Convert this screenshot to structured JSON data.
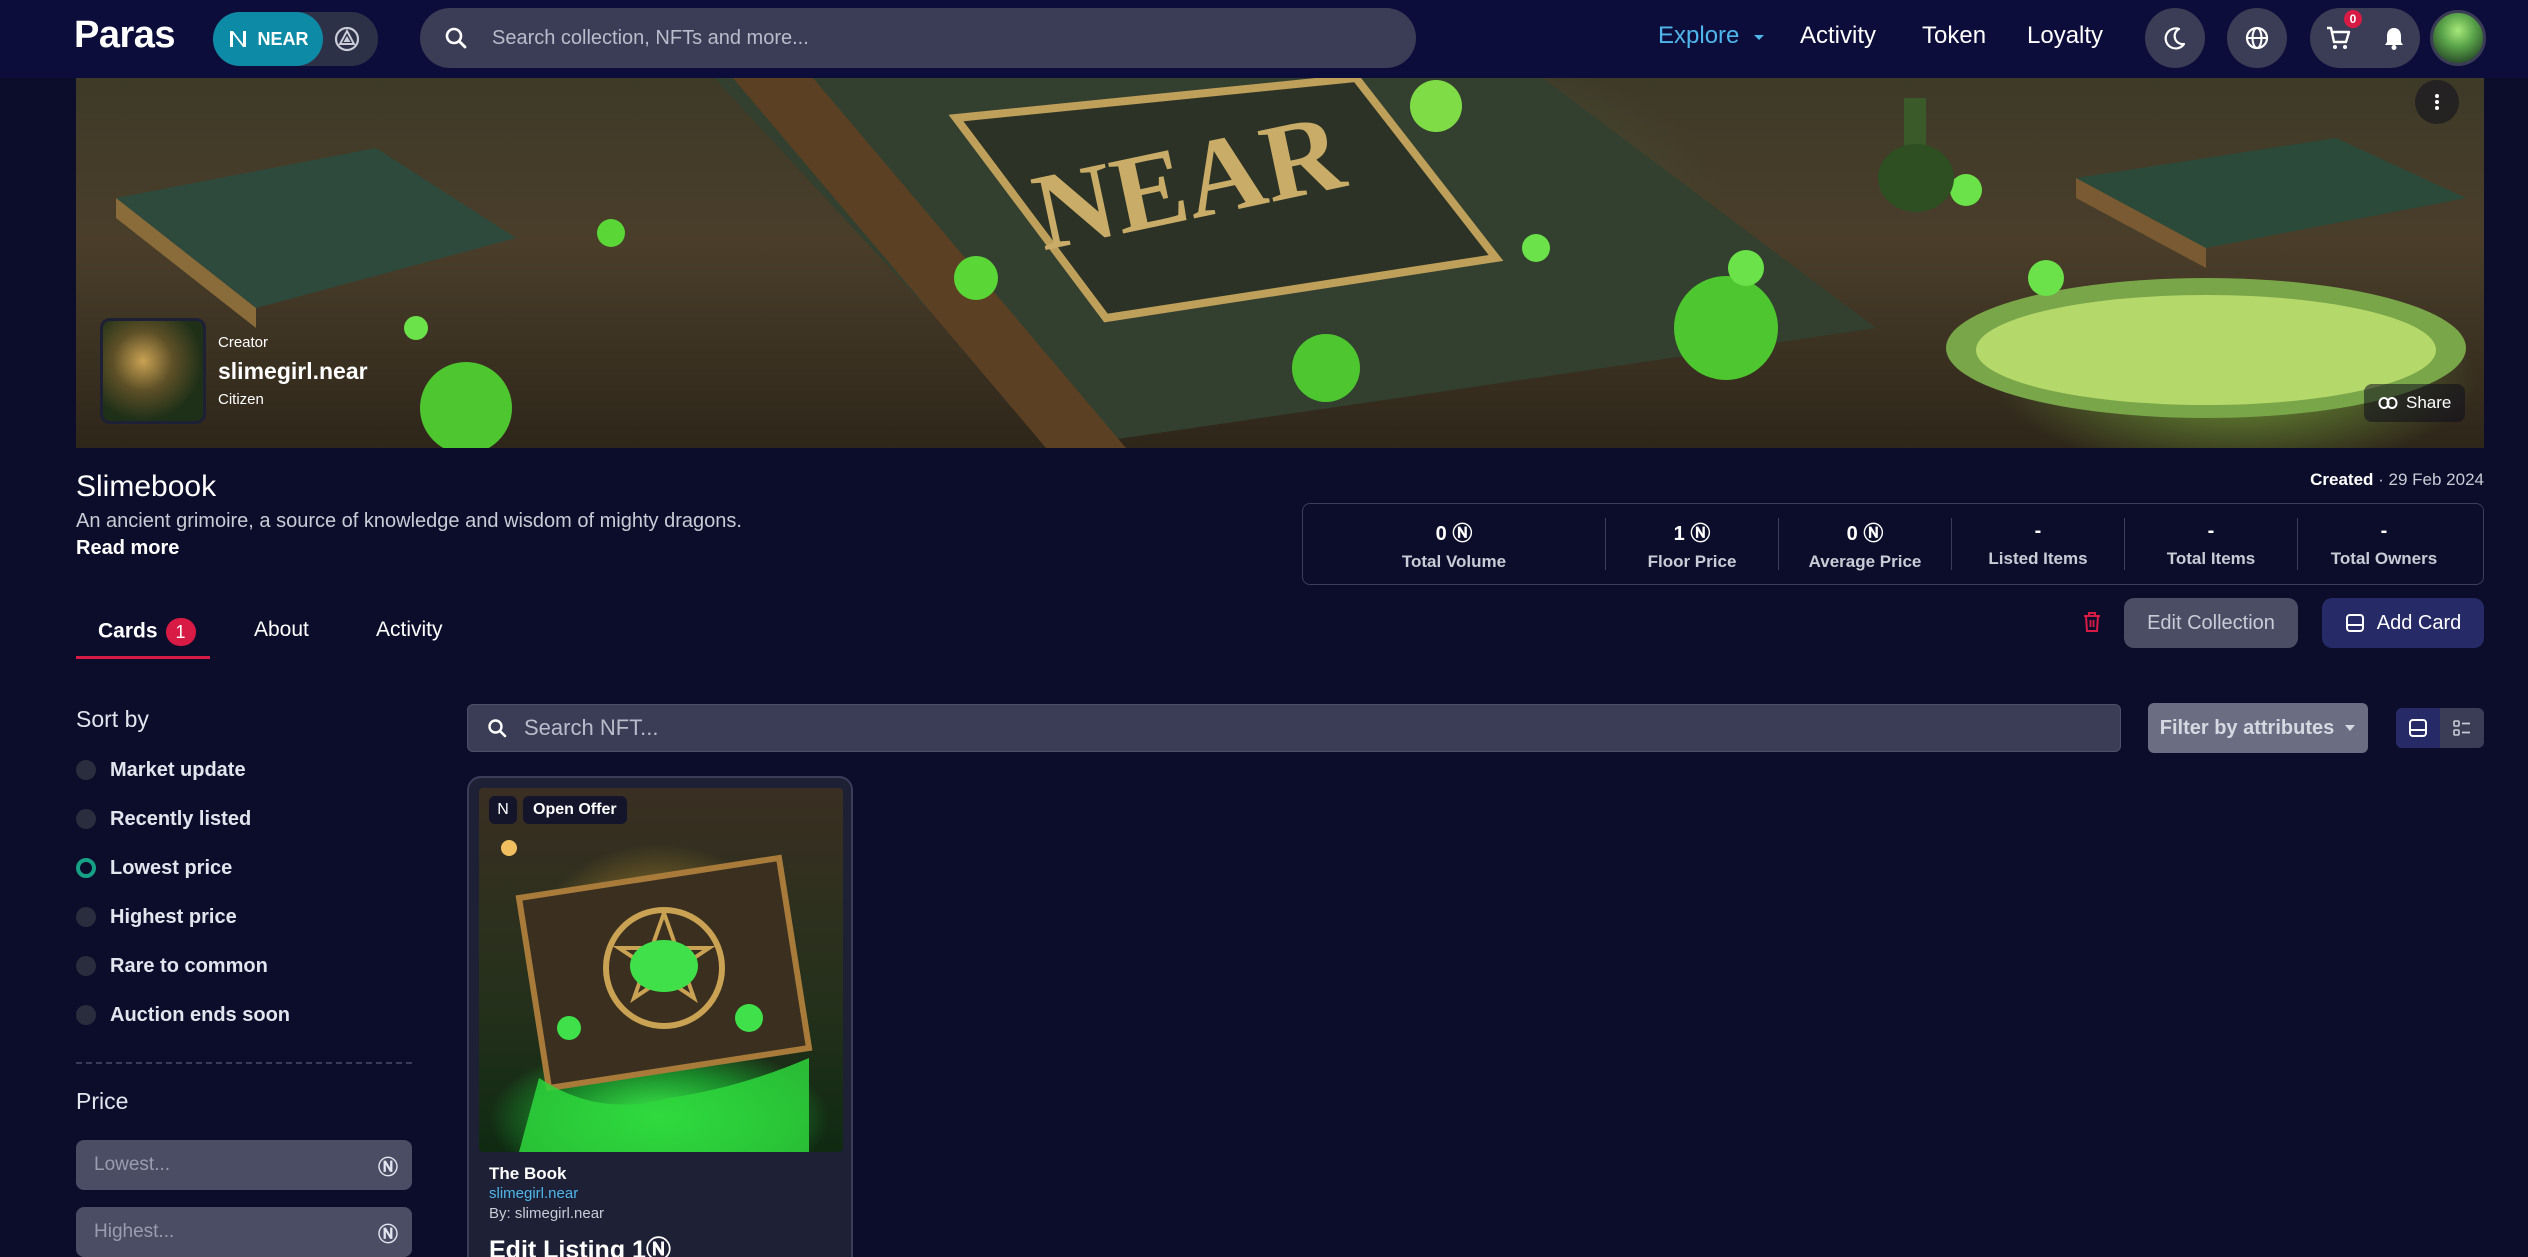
{
  "header": {
    "logo": "Paras",
    "chain": "NEAR",
    "search_placeholder": "Search collection, NFTs and more...",
    "nav": {
      "explore": "Explore",
      "activity": "Activity",
      "token": "Token",
      "loyalty": "Loyalty"
    },
    "cart_count": "0",
    "accent": "#4fb6ec"
  },
  "banner": {
    "creator_label": "Creator",
    "creator_name": "slimegirl.near",
    "creator_role": "Citizen",
    "share_label": "Share"
  },
  "collection": {
    "title": "Slimebook",
    "description": "An ancient grimoire, a source of knowledge and wisdom of mighty dragons.",
    "read_more": "Read more",
    "created_label": "Created",
    "created_date": "29 Feb 2024"
  },
  "stats": [
    {
      "value": "0 Ⓝ",
      "label": "Total Volume"
    },
    {
      "value": "1 Ⓝ",
      "label": "Floor Price"
    },
    {
      "value": "0 Ⓝ",
      "label": "Average Price"
    },
    {
      "value": "-",
      "label": "Listed Items"
    },
    {
      "value": "-",
      "label": "Total Items"
    },
    {
      "value": "-",
      "label": "Total Owners"
    }
  ],
  "tabs": {
    "cards": "Cards",
    "cards_count": "1",
    "about": "About",
    "activity": "Activity"
  },
  "actions": {
    "edit_collection": "Edit Collection",
    "add_card": "Add Card"
  },
  "sidebar": {
    "sort_title": "Sort by",
    "sort_options": [
      {
        "label": "Market update",
        "selected": false
      },
      {
        "label": "Recently listed",
        "selected": false
      },
      {
        "label": "Lowest price",
        "selected": true
      },
      {
        "label": "Highest price",
        "selected": false
      },
      {
        "label": "Rare to common",
        "selected": false
      },
      {
        "label": "Auction ends soon",
        "selected": false
      }
    ],
    "price_title": "Price",
    "price_low_placeholder": "Lowest...",
    "price_high_placeholder": "Highest...",
    "currency_symbol": "Ⓝ"
  },
  "main": {
    "search_placeholder": "Search NFT...",
    "filter_label": "Filter by attributes"
  },
  "card": {
    "chain_symbol": "N",
    "tag": "Open Offer",
    "title": "The Book",
    "collection": "slimegirl.near",
    "by": "By: slimegirl.near",
    "action": "Edit Listing 1Ⓝ"
  }
}
